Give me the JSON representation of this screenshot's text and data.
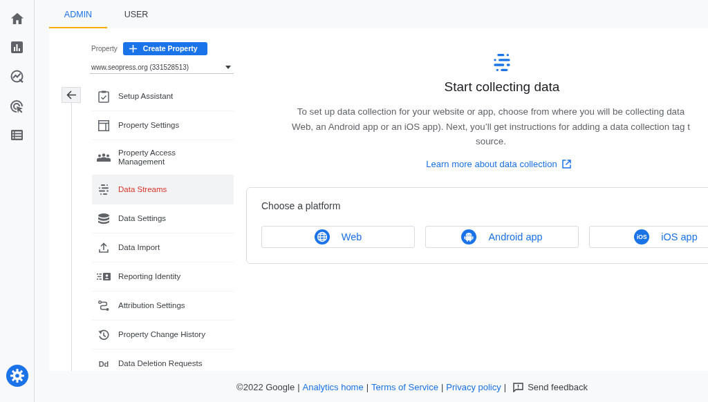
{
  "tabs": [
    {
      "label": "ADMIN",
      "selected": true
    },
    {
      "label": "USER",
      "selected": false
    }
  ],
  "property": {
    "label": "Property",
    "create_button": "Create Property",
    "selector": "www.seopress.org (331528513)"
  },
  "menu": [
    {
      "label": "Setup Assistant",
      "selected": false
    },
    {
      "label": "Property Settings",
      "selected": false
    },
    {
      "label": "Property Access Management",
      "selected": false
    },
    {
      "label": "Data Streams",
      "selected": true
    },
    {
      "label": "Data Settings",
      "selected": false
    },
    {
      "label": "Data Import",
      "selected": false
    },
    {
      "label": "Reporting Identity",
      "selected": false
    },
    {
      "label": "Attribution Settings",
      "selected": false
    },
    {
      "label": "Property Change History",
      "selected": false
    },
    {
      "label": "Data Deletion Requests",
      "selected": false,
      "icon_text": "Dd"
    }
  ],
  "main": {
    "title": "Start collecting data",
    "description": "To set up data collection for your website or app, choose from where you will be collecting data\nWeb, an Android app or an iOS app). Next, you’ll get instructions for adding a data collection tag t\nsource.",
    "learn_more": "Learn more about data collection"
  },
  "platform_card": {
    "title": "Choose a platform",
    "platforms": [
      {
        "label": "Web"
      },
      {
        "label": "Android app"
      },
      {
        "label": "iOS app",
        "badge": "iOS"
      }
    ]
  },
  "footer": [
    {
      "kind": "text",
      "text": "©2022 Google"
    },
    {
      "kind": "separator",
      "text": "|"
    },
    {
      "kind": "link",
      "text": "Analytics home"
    },
    {
      "kind": "separator",
      "text": "|"
    },
    {
      "kind": "link",
      "text": "Terms of Service"
    },
    {
      "kind": "separator",
      "text": "|"
    },
    {
      "kind": "link",
      "text": "Privacy policy"
    },
    {
      "kind": "separator",
      "text": "|"
    },
    {
      "kind": "feedback",
      "text": "Send feedback"
    }
  ]
}
